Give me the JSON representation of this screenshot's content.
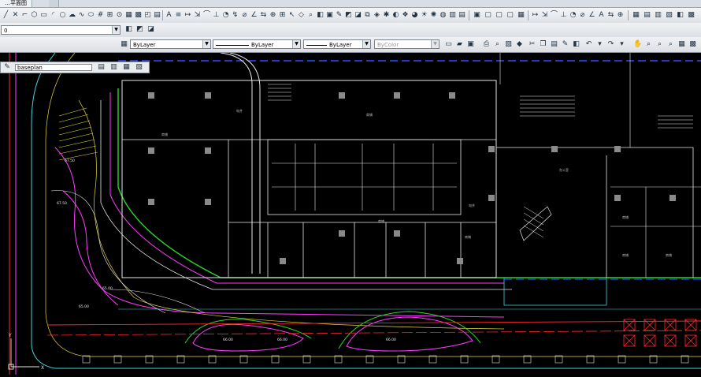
{
  "titlebar": {
    "tab_label": "…平面图"
  },
  "layer_combo": {
    "value": "0"
  },
  "properties": {
    "color": "ByLayer",
    "linetype": "ByLayer",
    "lineweight": "ByLayer",
    "plotstyle": "ByColor"
  },
  "layout": {
    "name": "baseplan"
  },
  "drawing": {
    "room_labels": [
      "商铺",
      "商铺",
      "商铺",
      "商铺",
      "办公室",
      "商铺",
      "电井",
      "电井",
      "商铺",
      "商铺"
    ],
    "elevation_labels": [
      "67.50",
      "67.50",
      "65.00",
      "65.00",
      "66.00",
      "66.00",
      "66.00"
    ],
    "ucs_labels": [
      "Y",
      "X"
    ]
  },
  "colors": {
    "canvas": "#000000",
    "walls": "#e8e8e8",
    "magenta": "#ff3cff",
    "red": "#ff2a2a",
    "green": "#29d629",
    "cyan": "#3fd6e0",
    "blue": "#3050ff",
    "yellow": "#e8d93a"
  }
}
